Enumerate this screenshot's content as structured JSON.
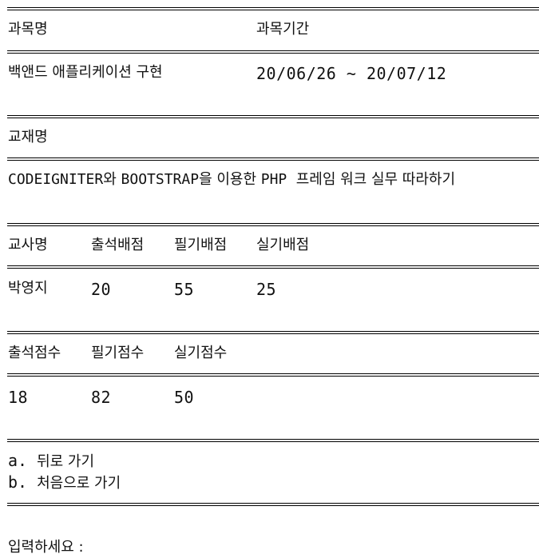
{
  "course": {
    "name_header": "과목명",
    "period_header": "과목기간",
    "name": "백앤드 애플리케이션 구현",
    "period": "20/06/26 ~ 20/07/12"
  },
  "textbook": {
    "header": "교재명",
    "parts": [
      "CODEIGNITER",
      "와 ",
      "BOOTSTRAP",
      "을 이용한 ",
      "PHP",
      "  프레임 워크 실무 따라하기"
    ]
  },
  "weights": {
    "headers": [
      "교사명",
      "출석배점",
      "필기배점",
      "실기배점"
    ],
    "teacher": "박영지",
    "values": [
      "20",
      "55",
      "25"
    ]
  },
  "scores": {
    "headers": [
      "출석점수",
      "필기점수",
      "실기점수"
    ],
    "values": [
      "18",
      "82",
      "50"
    ]
  },
  "menu": {
    "items": [
      {
        "key": "a.",
        "label": "뒤로 가기"
      },
      {
        "key": "b.",
        "label": "처음으로 가기"
      }
    ]
  },
  "prompt": "입력하세요 :"
}
